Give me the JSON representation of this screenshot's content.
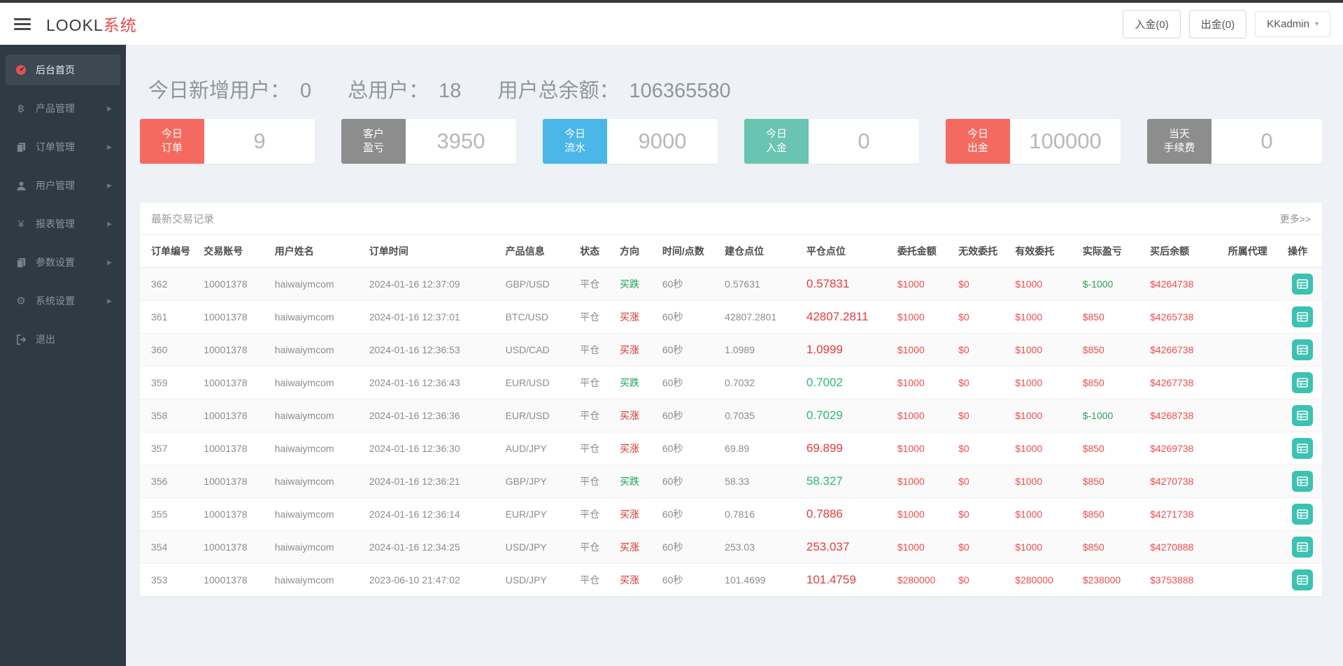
{
  "header": {
    "logo_black": "LOOKL",
    "logo_red": "系统",
    "deposit_button": "入金(0)",
    "withdraw_button": "出金(0)",
    "user_menu": "KKadmin",
    "accent_red": "#e8494f"
  },
  "sidebar": {
    "items": [
      {
        "label": "后台首页",
        "icon": "dashboard-icon",
        "active": true,
        "has_submenu": false
      },
      {
        "label": "产品管理",
        "icon": "bitcoin-icon",
        "active": false,
        "has_submenu": true
      },
      {
        "label": "订单管理",
        "icon": "files-icon",
        "active": false,
        "has_submenu": true
      },
      {
        "label": "用户管理",
        "icon": "user-icon",
        "active": false,
        "has_submenu": true
      },
      {
        "label": "报表管理",
        "icon": "yen-icon",
        "active": false,
        "has_submenu": true
      },
      {
        "label": "参数设置",
        "icon": "files-icon",
        "active": false,
        "has_submenu": true
      },
      {
        "label": "系统设置",
        "icon": "gears-icon",
        "active": false,
        "has_submenu": true
      },
      {
        "label": "退出",
        "icon": "logout-icon",
        "active": false,
        "has_submenu": false
      }
    ]
  },
  "summary": {
    "new_users_label": "今日新增用户：",
    "new_users_value": "0",
    "total_users_label": "总用户：",
    "total_users_value": "18",
    "total_balance_label": "用户总余额：",
    "total_balance_value": "106365580"
  },
  "stat_cards": [
    {
      "label1": "今日",
      "label2": "订单",
      "value": "9",
      "color": "#f56a60"
    },
    {
      "label1": "客户",
      "label2": "盈亏",
      "value": "3950",
      "color": "#8d8d8d"
    },
    {
      "label1": "今日",
      "label2": "流水",
      "value": "9000",
      "color": "#4bb6e8"
    },
    {
      "label1": "今日",
      "label2": "入金",
      "value": "0",
      "color": "#69c4b2"
    },
    {
      "label1": "今日",
      "label2": "出金",
      "value": "100000",
      "color": "#f56a60"
    },
    {
      "label1": "当天",
      "label2": "手续费",
      "value": "0",
      "color": "#8d8d8d"
    }
  ],
  "table": {
    "title": "最新交易记录",
    "more_link": "更多>>",
    "columns": [
      "订单编号",
      "交易账号",
      "用户姓名",
      "订单时间",
      "产品信息",
      "状态",
      "方向",
      "时间/点数",
      "建仓点位",
      "平仓点位",
      "委托金额",
      "无效委托",
      "有效委托",
      "实际盈亏",
      "买后余额",
      "所属代理",
      "操作"
    ],
    "rows": [
      {
        "id": "362",
        "account": "10001378",
        "name": "haiwaiymcom",
        "time": "2024-01-16 12:37:09",
        "product": "GBP/USD",
        "status": "平仓",
        "direction": "买跌",
        "dir_color": "green",
        "period": "60秒",
        "open": "0.57631",
        "close": "0.57831",
        "close_color": "red",
        "amount": "$1000",
        "invalid": "$0",
        "valid": "$1000",
        "pl": "$-1000",
        "pl_color": "green",
        "balance": "$4264738",
        "agent": ""
      },
      {
        "id": "361",
        "account": "10001378",
        "name": "haiwaiymcom",
        "time": "2024-01-16 12:37:01",
        "product": "BTC/USD",
        "status": "平仓",
        "direction": "买涨",
        "dir_color": "red",
        "period": "60秒",
        "open": "42807.2801",
        "close": "42807.2811",
        "close_color": "red",
        "amount": "$1000",
        "invalid": "$0",
        "valid": "$1000",
        "pl": "$850",
        "pl_color": "red",
        "balance": "$4265738",
        "agent": ""
      },
      {
        "id": "360",
        "account": "10001378",
        "name": "haiwaiymcom",
        "time": "2024-01-16 12:36:53",
        "product": "USD/CAD",
        "status": "平仓",
        "direction": "买涨",
        "dir_color": "red",
        "period": "60秒",
        "open": "1.0989",
        "close": "1.0999",
        "close_color": "red",
        "amount": "$1000",
        "invalid": "$0",
        "valid": "$1000",
        "pl": "$850",
        "pl_color": "red",
        "balance": "$4266738",
        "agent": ""
      },
      {
        "id": "359",
        "account": "10001378",
        "name": "haiwaiymcom",
        "time": "2024-01-16 12:36:43",
        "product": "EUR/USD",
        "status": "平仓",
        "direction": "买跌",
        "dir_color": "green",
        "period": "60秒",
        "open": "0.7032",
        "close": "0.7002",
        "close_color": "green",
        "amount": "$1000",
        "invalid": "$0",
        "valid": "$1000",
        "pl": "$850",
        "pl_color": "red",
        "balance": "$4267738",
        "agent": ""
      },
      {
        "id": "358",
        "account": "10001378",
        "name": "haiwaiymcom",
        "time": "2024-01-16 12:36:36",
        "product": "EUR/USD",
        "status": "平仓",
        "direction": "买涨",
        "dir_color": "red",
        "period": "60秒",
        "open": "0.7035",
        "close": "0.7029",
        "close_color": "green",
        "amount": "$1000",
        "invalid": "$0",
        "valid": "$1000",
        "pl": "$-1000",
        "pl_color": "green",
        "balance": "$4268738",
        "agent": ""
      },
      {
        "id": "357",
        "account": "10001378",
        "name": "haiwaiymcom",
        "time": "2024-01-16 12:36:30",
        "product": "AUD/JPY",
        "status": "平仓",
        "direction": "买涨",
        "dir_color": "red",
        "period": "60秒",
        "open": "69.89",
        "close": "69.899",
        "close_color": "red",
        "amount": "$1000",
        "invalid": "$0",
        "valid": "$1000",
        "pl": "$850",
        "pl_color": "red",
        "balance": "$4269738",
        "agent": ""
      },
      {
        "id": "356",
        "account": "10001378",
        "name": "haiwaiymcom",
        "time": "2024-01-16 12:36:21",
        "product": "GBP/JPY",
        "status": "平仓",
        "direction": "买跌",
        "dir_color": "green",
        "period": "60秒",
        "open": "58.33",
        "close": "58.327",
        "close_color": "green",
        "amount": "$1000",
        "invalid": "$0",
        "valid": "$1000",
        "pl": "$850",
        "pl_color": "red",
        "balance": "$4270738",
        "agent": ""
      },
      {
        "id": "355",
        "account": "10001378",
        "name": "haiwaiymcom",
        "time": "2024-01-16 12:36:14",
        "product": "EUR/JPY",
        "status": "平仓",
        "direction": "买涨",
        "dir_color": "red",
        "period": "60秒",
        "open": "0.7816",
        "close": "0.7886",
        "close_color": "red",
        "amount": "$1000",
        "invalid": "$0",
        "valid": "$1000",
        "pl": "$850",
        "pl_color": "red",
        "balance": "$4271738",
        "agent": ""
      },
      {
        "id": "354",
        "account": "10001378",
        "name": "haiwaiymcom",
        "time": "2024-01-16 12:34:25",
        "product": "USD/JPY",
        "status": "平仓",
        "direction": "买涨",
        "dir_color": "red",
        "period": "60秒",
        "open": "253.03",
        "close": "253.037",
        "close_color": "red",
        "amount": "$1000",
        "invalid": "$0",
        "valid": "$1000",
        "pl": "$850",
        "pl_color": "red",
        "balance": "$4270888",
        "agent": ""
      },
      {
        "id": "353",
        "account": "10001378",
        "name": "haiwaiymcom",
        "time": "2023-06-10 21:47:02",
        "product": "USD/JPY",
        "status": "平仓",
        "direction": "买涨",
        "dir_color": "red",
        "period": "60秒",
        "open": "101.4699",
        "close": "101.4759",
        "close_color": "red",
        "amount": "$280000",
        "invalid": "$0",
        "valid": "$280000",
        "pl": "$238000",
        "pl_color": "red",
        "balance": "$3753888",
        "agent": ""
      }
    ]
  },
  "colors": {
    "sidebar_bg": "#2e3a44",
    "main_bg": "#eef1f5",
    "up_red": "#d4302c",
    "down_green": "#17a352",
    "money_red": "#ef4c4c",
    "profit_green": "#2e9e5b",
    "op_button_teal": "#3cc2b2"
  }
}
